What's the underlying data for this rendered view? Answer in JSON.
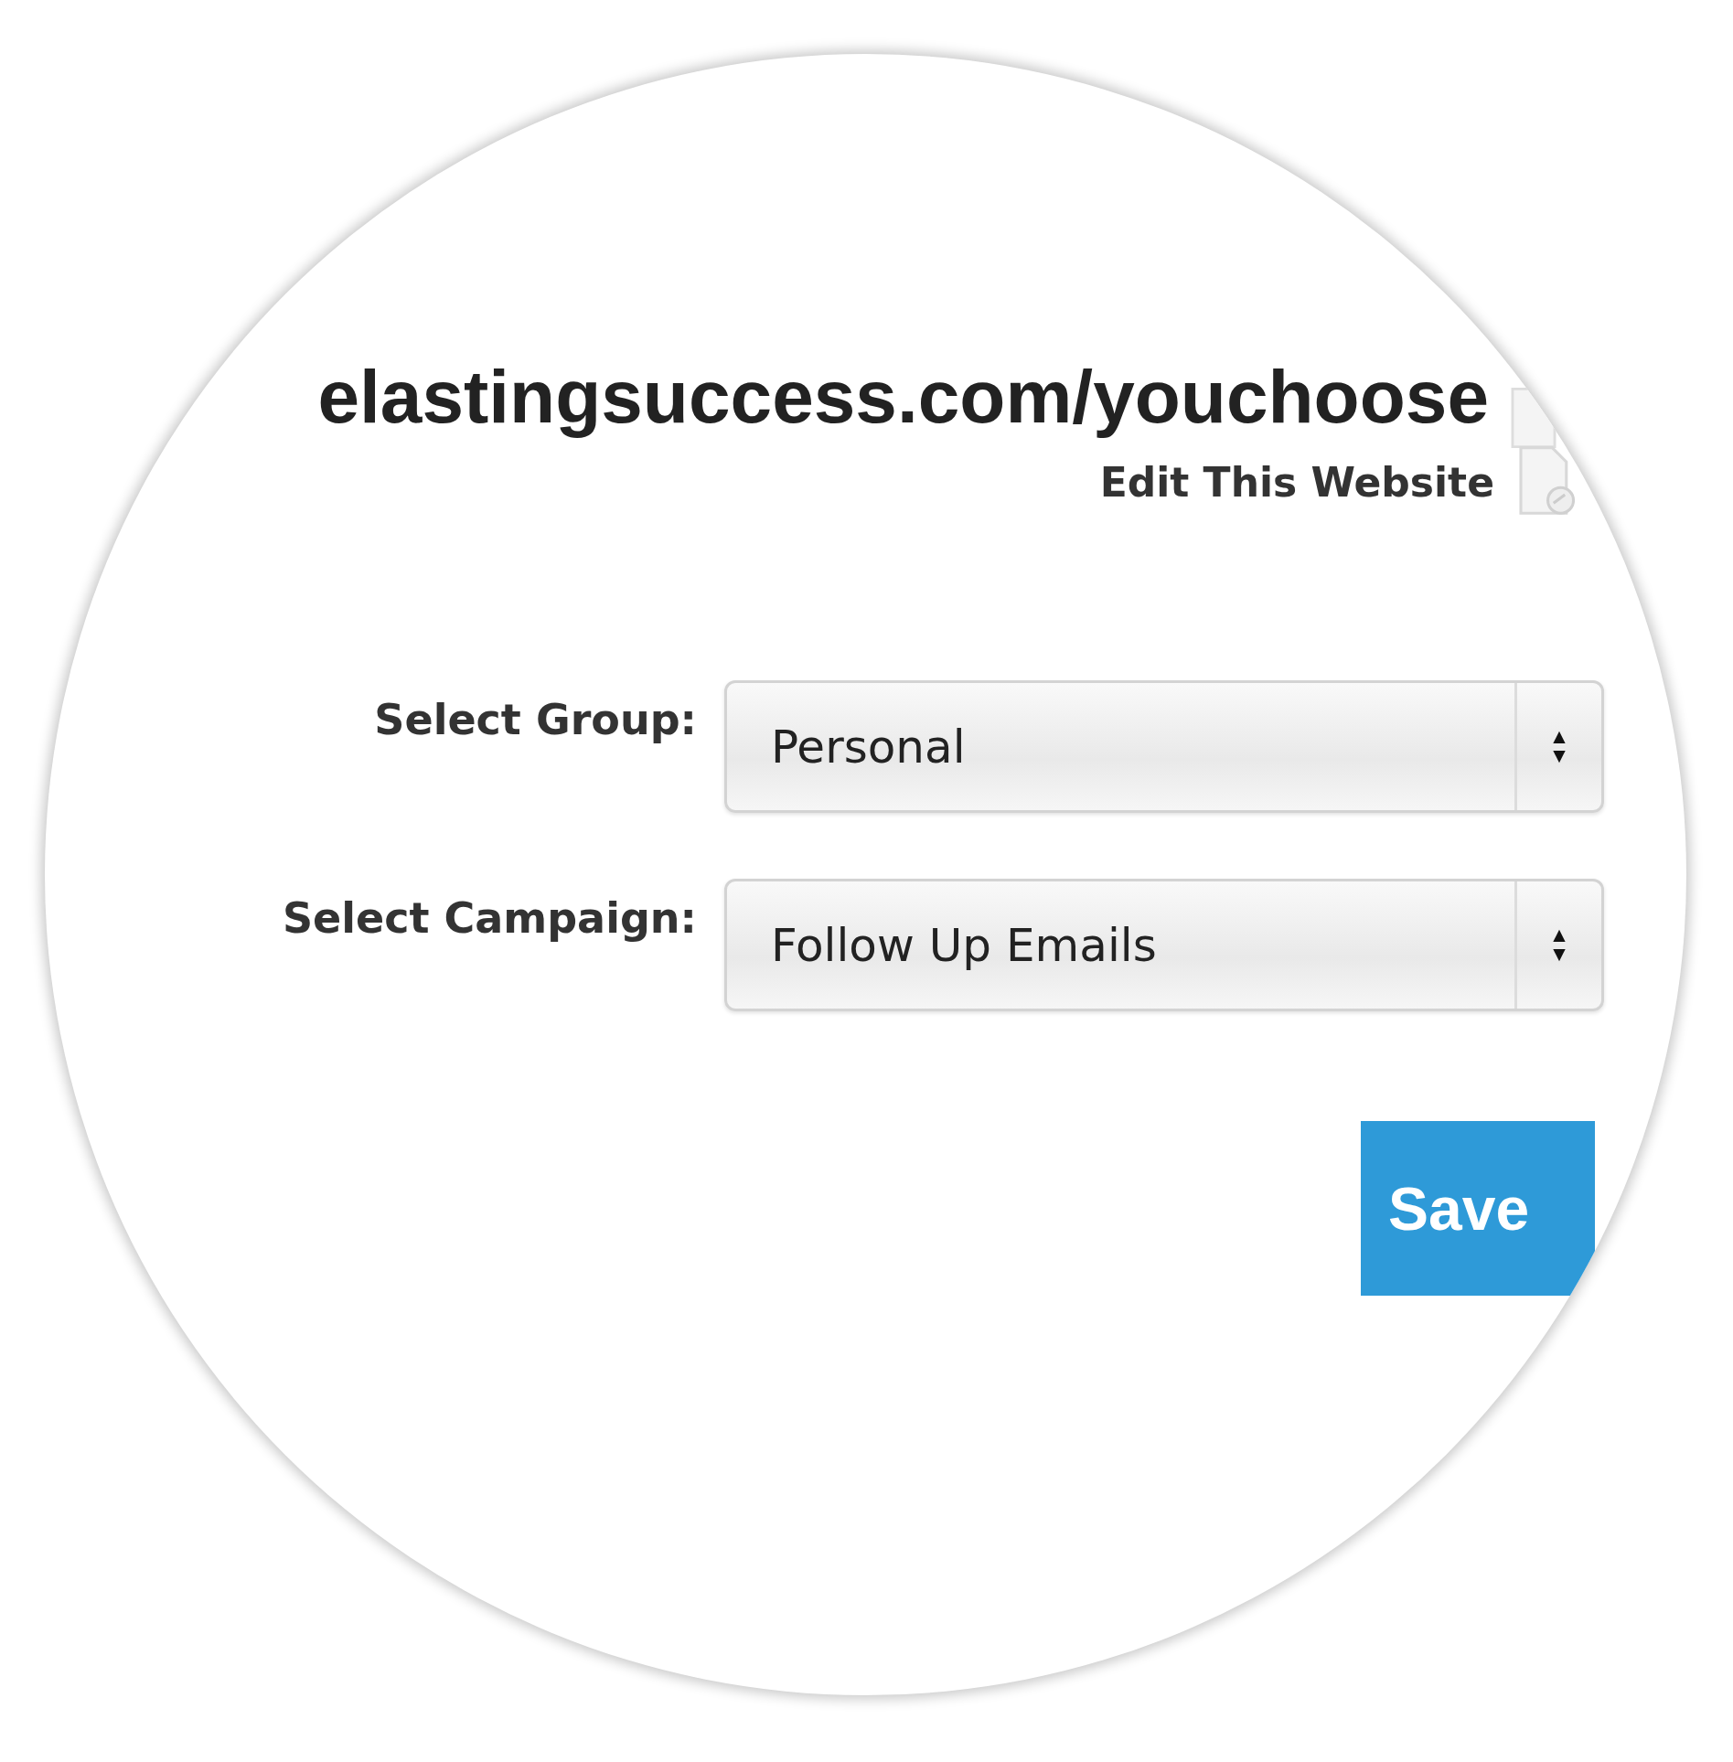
{
  "header": {
    "url": "elastingsuccess.com/youchoose",
    "edit_link": "Edit This Website"
  },
  "fields": [
    {
      "label": "Select Group:",
      "value": "Personal"
    },
    {
      "label": "Select Campaign:",
      "value": "Follow Up Emails"
    }
  ],
  "buttons": [
    "Save"
  ]
}
